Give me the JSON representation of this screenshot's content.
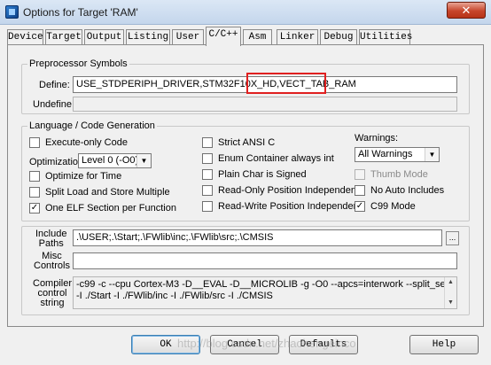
{
  "window": {
    "title": "Options for Target 'RAM'",
    "close_label": "✕"
  },
  "tabs": [
    {
      "label": "Device"
    },
    {
      "label": "Target"
    },
    {
      "label": "Output"
    },
    {
      "label": "Listing"
    },
    {
      "label": "User"
    },
    {
      "label": "C/C++"
    },
    {
      "label": "Asm"
    },
    {
      "label": "Linker"
    },
    {
      "label": "Debug"
    },
    {
      "label": "Utilities"
    }
  ],
  "active_tab": "C/C++",
  "preprocessor": {
    "legend": "Preprocessor Symbols",
    "define_label": "Define:",
    "define_value": "USE_STDPERIPH_DRIVER,STM32F10X_HD,VECT_TAB_RAM",
    "undefine_label": "Undefine:",
    "undefine_value": ""
  },
  "language": {
    "legend": "Language / Code Generation",
    "execute_only": {
      "label": "Execute-only Code",
      "checked": false
    },
    "optimization_label": "Optimization:",
    "optimization_value": "Level 0 (-O0)",
    "optimize_time": {
      "label": "Optimize for Time",
      "checked": false
    },
    "split_load": {
      "label": "Split Load and Store Multiple",
      "checked": false
    },
    "one_elf": {
      "label": "One ELF Section per Function",
      "checked": true
    },
    "strict_ansi": {
      "label": "Strict ANSI C",
      "checked": false
    },
    "enum_container": {
      "label": "Enum Container always int",
      "checked": false
    },
    "plain_char": {
      "label": "Plain Char is Signed",
      "checked": false
    },
    "readonly_pi": {
      "label": "Read-Only Position Independent",
      "checked": false
    },
    "readwrite_pi": {
      "label": "Read-Write Position Independent",
      "checked": false
    },
    "warnings_label": "Warnings:",
    "warnings_value": "All Warnings",
    "thumb_mode": {
      "label": "Thumb Mode",
      "checked": false,
      "disabled": true
    },
    "no_auto_includes": {
      "label": "No Auto Includes",
      "checked": false
    },
    "c99_mode": {
      "label": "C99 Mode",
      "checked": true
    }
  },
  "include": {
    "label_line1": "Include",
    "label_line2": "Paths",
    "value": ".\\USER;.\\Start;.\\FWlib\\inc;.\\FWlib\\src;.\\CMSIS",
    "browse_label": "..."
  },
  "misc": {
    "label_line1": "Misc",
    "label_line2": "Controls",
    "value": ""
  },
  "compiler": {
    "label_line1": "Compiler",
    "label_line2": "control",
    "label_line3": "string",
    "line1": "-c99 -c --cpu Cortex-M3 -D__EVAL -D__MICROLIB -g -O0 --apcs=interwork --split_sections -I ./USER",
    "line2": "-I ./Start -I ./FWlib/inc -I ./FWlib/src -I ./CMSIS"
  },
  "buttons": {
    "ok": "OK",
    "cancel": "Cancel",
    "defaults": "Defaults",
    "help": "Help"
  },
  "watermark": "http://blog.csdn.net/zhaohengeinco"
}
